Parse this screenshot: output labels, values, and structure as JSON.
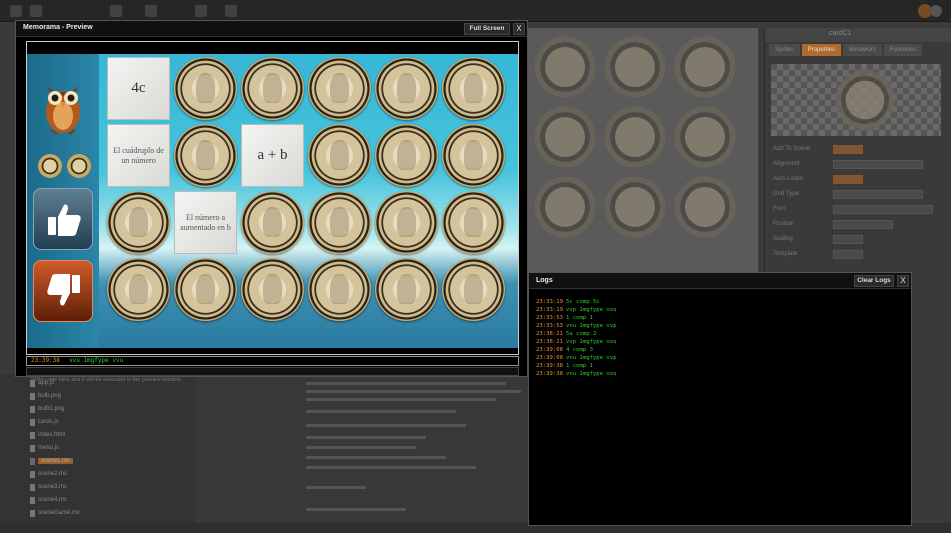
{
  "colors": {
    "accent": "#b06a2c",
    "log_time": "#e8912b",
    "log_msg": "#2fce2f"
  },
  "preview": {
    "title": "Memorama - Preview",
    "fullscreen_label": "Full Screen",
    "close_label": "X",
    "console_time": "23:39:38",
    "console_msg": "vvu 1mgfype vvu",
    "input_placeholder": "Write code here and it will be executed in the preview window"
  },
  "game": {
    "owl_icon": "owl-icon",
    "like_icon": "thumbs-up-icon",
    "dislike_icon": "thumbs-down-icon",
    "board": [
      [
        {
          "t": "text",
          "v": "4c",
          "s": "big"
        },
        {
          "t": "coin"
        },
        {
          "t": "coin"
        },
        {
          "t": "coin"
        },
        {
          "t": "coin"
        },
        {
          "t": "coin"
        }
      ],
      [
        {
          "t": "text",
          "v": "El cuádruplo de un número",
          "s": "small"
        },
        {
          "t": "coin"
        },
        {
          "t": "text",
          "v": "a + b",
          "s": "big"
        },
        {
          "t": "coin"
        },
        {
          "t": "coin"
        },
        {
          "t": "coin"
        }
      ],
      [
        {
          "t": "coin"
        },
        {
          "t": "text",
          "v": "El número a aumentado en b",
          "s": "small"
        },
        {
          "t": "coin"
        },
        {
          "t": "coin"
        },
        {
          "t": "coin"
        },
        {
          "t": "coin"
        }
      ],
      [
        {
          "t": "coin"
        },
        {
          "t": "coin"
        },
        {
          "t": "coin"
        },
        {
          "t": "coin"
        },
        {
          "t": "coin"
        },
        {
          "t": "coin"
        }
      ]
    ]
  },
  "logs": {
    "title": "Logs",
    "clear_label": "Clear Logs",
    "close_label": "X",
    "entries": [
      {
        "time": "23:33:19",
        "msg": "5c comp 5c"
      },
      {
        "time": "23:33:19",
        "msg": "vvp 1mgfype vvu"
      },
      {
        "time": "23:33:53",
        "msg": "1 comp 1"
      },
      {
        "time": "23:33:53",
        "msg": "vvu 1mgfype vvp"
      },
      {
        "time": "23:38:21",
        "msg": "5a comp 2"
      },
      {
        "time": "23:38:21",
        "msg": "vvp 1mgfype vvu"
      },
      {
        "time": "23:39:08",
        "msg": "4 comp 3"
      },
      {
        "time": "23:39:08",
        "msg": "vvu 1mgfype vvp"
      },
      {
        "time": "23:39:38",
        "msg": "1 comp 1"
      },
      {
        "time": "23:39:38",
        "msg": "vvu 1mgfype vvu"
      }
    ]
  },
  "ide": {
    "card_name": "cardC1",
    "tabs": [
      "Sprites",
      "Properties",
      "Behaviors",
      "Functions"
    ],
    "props": [
      "Add To Scene",
      "Alignment",
      "Auto Listen",
      "Grid Type",
      "Font",
      "Position",
      "Scaling",
      "Template"
    ],
    "files": [
      "app.js",
      "bulb.png",
      "bulb1.png",
      "cards.js",
      "index.html",
      "menu.js",
      "scene1.mc",
      "scene2.mc",
      "scene3.mc",
      "scene4.mc",
      "sceneGame.mc"
    ]
  }
}
